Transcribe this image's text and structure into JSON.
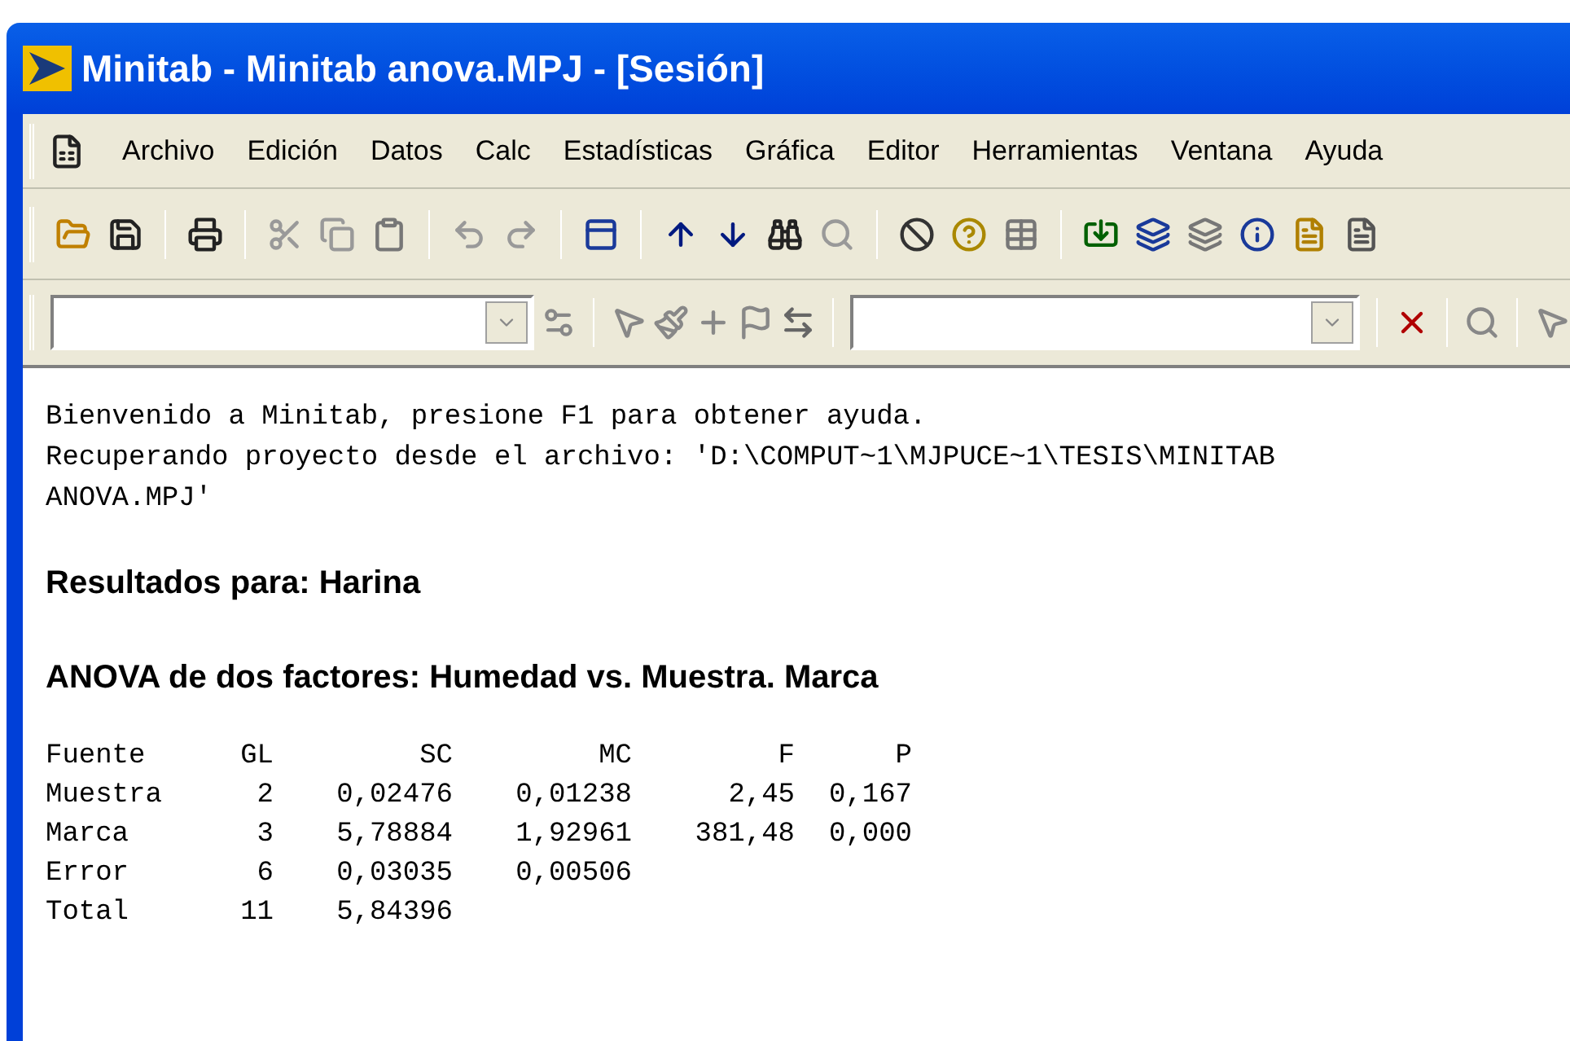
{
  "window": {
    "title": "Minitab - Minitab anova.MPJ - [Sesión]"
  },
  "menu": [
    "Archivo",
    "Edición",
    "Datos",
    "Calc",
    "Estadísticas",
    "Gráfica",
    "Editor",
    "Herramientas",
    "Ventana",
    "Ayuda"
  ],
  "session": {
    "messages": [
      "Bienvenido a Minitab, presione F1 para obtener ayuda.",
      "Recuperando proyecto desde el archivo: 'D:\\COMPUT~1\\MJPUCE~1\\TESIS\\MINITAB ANOVA.MPJ'"
    ],
    "results_heading": "Resultados para: Harina",
    "anova_heading": "ANOVA de dos factores: Humedad vs. Muestra. Marca",
    "table": {
      "columns": [
        "Fuente",
        "GL",
        "SC",
        "MC",
        "F",
        "P"
      ],
      "rows": [
        [
          "Muestra",
          "2",
          "0,02476",
          "0,01238",
          "2,45",
          "0,167"
        ],
        [
          "Marca",
          "3",
          "5,78884",
          "1,92961",
          "381,48",
          "0,000"
        ],
        [
          "Error",
          "6",
          "0,03035",
          "0,00506",
          "",
          ""
        ],
        [
          "Total",
          "11",
          "5,84396",
          "",
          "",
          ""
        ]
      ]
    }
  }
}
